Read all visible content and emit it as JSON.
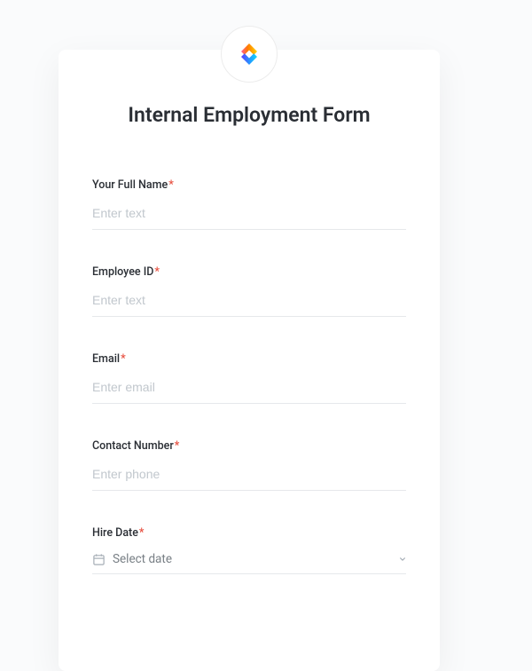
{
  "form": {
    "title": "Internal Employment Form",
    "fields": {
      "full_name": {
        "label": "Your Full Name",
        "placeholder": "Enter text",
        "required_mark": "*"
      },
      "employee_id": {
        "label": "Employee ID",
        "placeholder": "Enter text",
        "required_mark": "*"
      },
      "email": {
        "label": "Email",
        "placeholder": "Enter email",
        "required_mark": "*"
      },
      "contact_number": {
        "label": "Contact Number",
        "placeholder": "Enter phone",
        "required_mark": "*"
      },
      "hire_date": {
        "label": "Hire Date",
        "placeholder": "Select date",
        "required_mark": "*"
      }
    }
  }
}
